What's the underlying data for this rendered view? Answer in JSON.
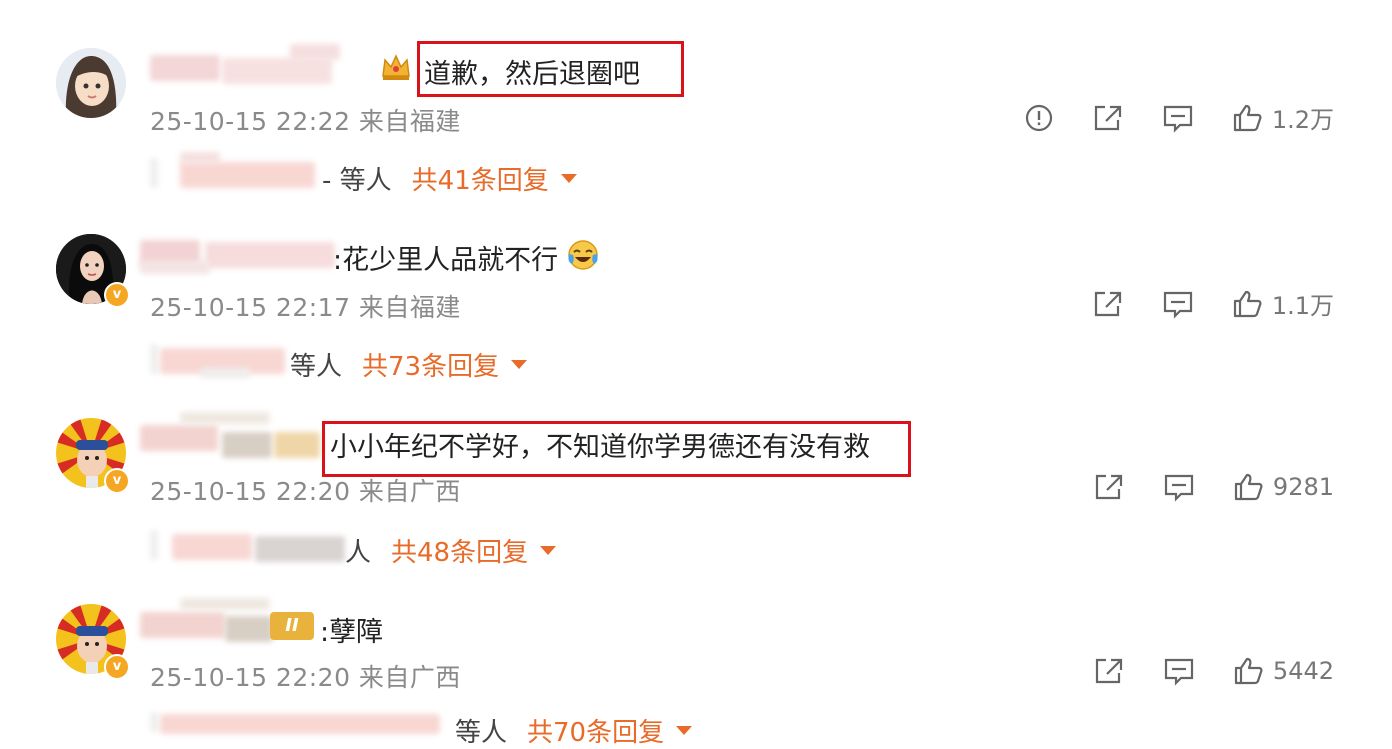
{
  "comments": [
    {
      "text": "道歉，然后退圈吧",
      "meta": "25-10-15 22:22 来自福建",
      "likes": "1.2万",
      "reply_who": "- 等人",
      "reply_total": "共41条回复",
      "has_report": true
    },
    {
      "text": ":花少里人品就不行",
      "meta": "25-10-15 22:17 来自福建",
      "likes": "1.1万",
      "reply_who": "等人",
      "reply_total": "共73条回复",
      "has_report": false
    },
    {
      "text": "小小年纪不学好，不知道你学男德还有没有救",
      "meta": "25-10-15 22:20 来自广西",
      "likes": "9281",
      "reply_who": "人",
      "reply_total": "共48条回复",
      "has_report": false
    },
    {
      "text": ":孽障",
      "meta": "25-10-15 22:20 来自广西",
      "likes": "5442",
      "reply_who": "等人",
      "reply_total": "共70条回复",
      "has_report": false
    }
  ],
  "icons": {
    "report": "report-icon",
    "share": "share-icon",
    "comment": "comment-icon",
    "like": "like-icon",
    "laugh": "laugh-cry-emoji"
  },
  "colors": {
    "accent": "#e86b2a",
    "highlight_box": "#d9121b",
    "meta_text": "#8a8a8a",
    "verified": "#f5a623"
  },
  "level_badge": "II"
}
